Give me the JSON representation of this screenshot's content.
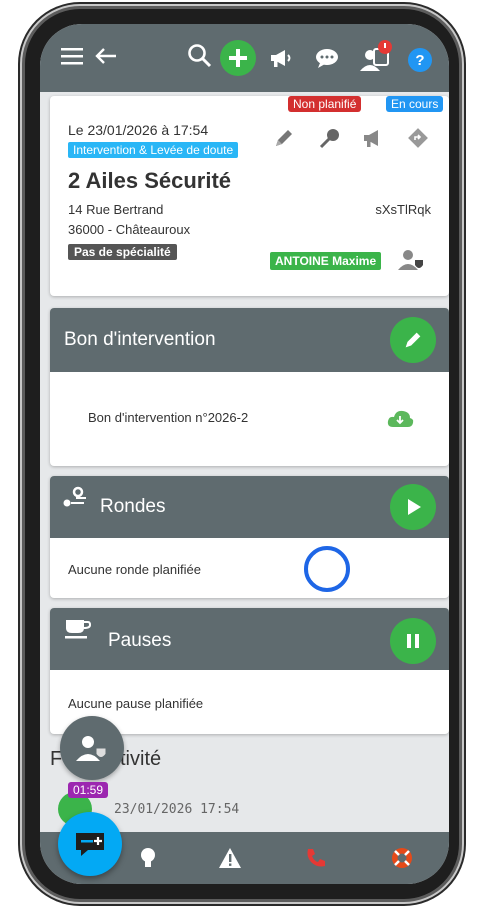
{
  "header": {
    "icons": [
      "menu-icon",
      "back-arrow-icon",
      "search-icon",
      "add-icon",
      "megaphone-icon",
      "chat-icon",
      "notification-user-icon",
      "help-icon"
    ]
  },
  "intervention": {
    "status_not_planned": "Non planifié",
    "status_in_progress": "En cours",
    "date": "Le 23/01/2026 à 17:54",
    "type": "Intervention & Levée de doute",
    "client": "2 Ailes Sécurité",
    "address_line1": "14 Rue Bertrand",
    "address_line2": "36000 - Châteauroux",
    "code": "sXsTlRqk",
    "speciality": "Pas de spécialité",
    "agent": "ANTOINE Maxime"
  },
  "bon": {
    "title": "Bon d'intervention",
    "item": "Bon d'intervention n°2026-2"
  },
  "rondes": {
    "title": "Rondes",
    "empty": "Aucune ronde planifiée"
  },
  "pauses": {
    "title": "Pauses",
    "empty": "Aucune pause planifiée"
  },
  "activity": {
    "title_visible": "F",
    "title_visible_end": "tivité",
    "timer": "01:59",
    "entry_time": "23/01/2026 17:54"
  },
  "colors": {
    "header_bg": "#5f6b6f",
    "green": "#3bb44a",
    "red": "#d32f2f",
    "blue": "#2196f3",
    "cyan": "#29b6f6",
    "purple": "#9c27b0"
  }
}
